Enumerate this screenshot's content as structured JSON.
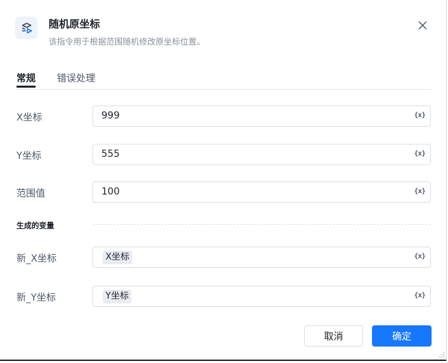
{
  "header": {
    "title": "随机原坐标",
    "subtitle": "该指令用于根据范围随机修改原坐标位置。",
    "icon": "random-coordinate-icon",
    "accent": "#1677ff"
  },
  "tabs": [
    {
      "label": "常规",
      "active": true
    },
    {
      "label": "错误处理",
      "active": false
    }
  ],
  "fields": {
    "x": {
      "label": "X坐标",
      "value": "999"
    },
    "y": {
      "label": "Y坐标",
      "value": "555"
    },
    "range": {
      "label": "范围值",
      "value": "100"
    }
  },
  "variable_button": "{x}",
  "output_section": {
    "title": "生成的变量",
    "new_x": {
      "label": "新_X坐标",
      "chip": "X坐标"
    },
    "new_y": {
      "label": "新_Y坐标",
      "chip": "Y坐标"
    }
  },
  "footer": {
    "cancel": "取消",
    "confirm": "确定"
  }
}
